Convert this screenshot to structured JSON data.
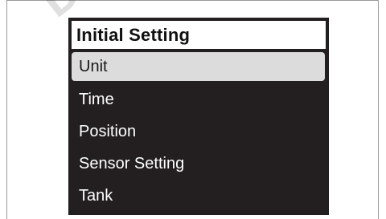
{
  "watermark": "DO",
  "screen": {
    "title": "Initial Setting",
    "menu_items": [
      {
        "label": "Unit",
        "selected": true
      },
      {
        "label": "Time",
        "selected": false
      },
      {
        "label": "Position",
        "selected": false
      },
      {
        "label": "Sensor Setting",
        "selected": false
      },
      {
        "label": "Tank",
        "selected": false
      }
    ]
  },
  "colors": {
    "screen_background": "#231f20",
    "header_background": "#ffffff",
    "selection_highlight": "#dcdcdc",
    "menu_text": "#ffffff"
  }
}
